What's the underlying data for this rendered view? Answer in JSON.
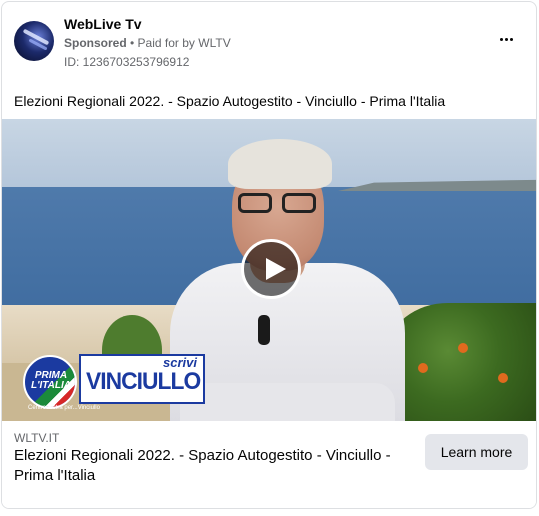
{
  "post": {
    "page_name": "WebLive Tv",
    "sponsored": "Sponsored",
    "separator": " • ",
    "paid_for_prefix": "Paid for by ",
    "paid_for_by": "WLTV",
    "ad_id": "ID: 1236703253796912",
    "caption": "Elezioni Regionali 2022. - Spazio Autogestito - Vinciullo - Prima l'Italia",
    "more_icon": "more-horizontal-icon"
  },
  "video": {
    "play_icon": "play-icon",
    "overlay": {
      "party_logo_text": "PRIMA\nL'ITALIA",
      "party_logo_sub": "Centrodestra per...Vinciullo",
      "scrivi": "scrivi",
      "name": "VINCIULLO"
    }
  },
  "link": {
    "domain": "WLTV.IT",
    "title": "Elezioni Regionali 2022. - Spazio Autogestito - Vinciullo - Prima l'Italia",
    "cta": "Learn more"
  },
  "colors": {
    "brand_blue": "#1b3aa0",
    "text_primary": "#050505",
    "text_secondary": "#65676b",
    "button_bg": "#e4e6eb"
  }
}
